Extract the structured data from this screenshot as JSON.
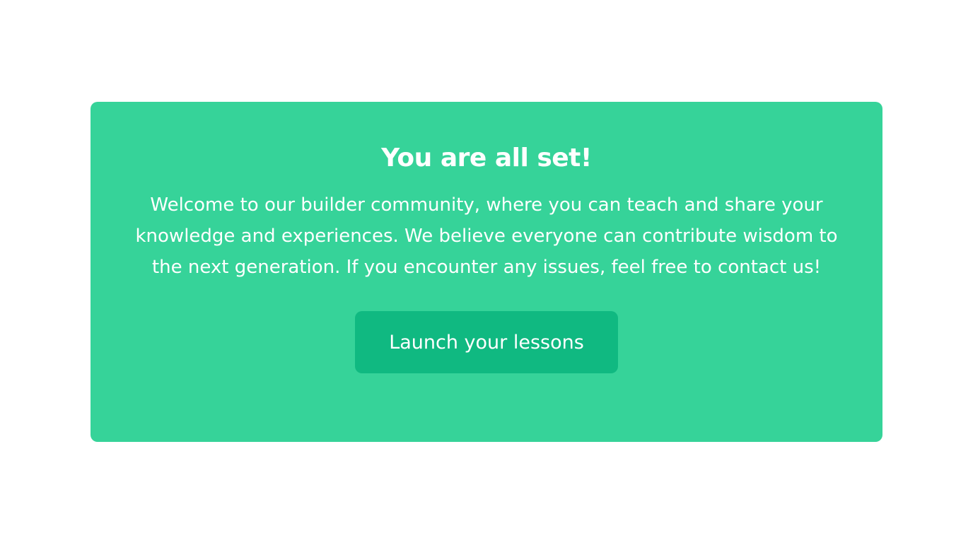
{
  "colors": {
    "page_background": "#ffffff",
    "card_background": "#36d399",
    "button_background": "#10b981",
    "text": "#ffffff"
  },
  "card": {
    "title": "You are all set!",
    "message": "Welcome to our builder community, where you can teach and share your knowledge and experiences. We believe everyone can contribute wisdom to the next generation. If you encounter any issues, feel free to contact us!",
    "button_label": "Launch your lessons"
  }
}
